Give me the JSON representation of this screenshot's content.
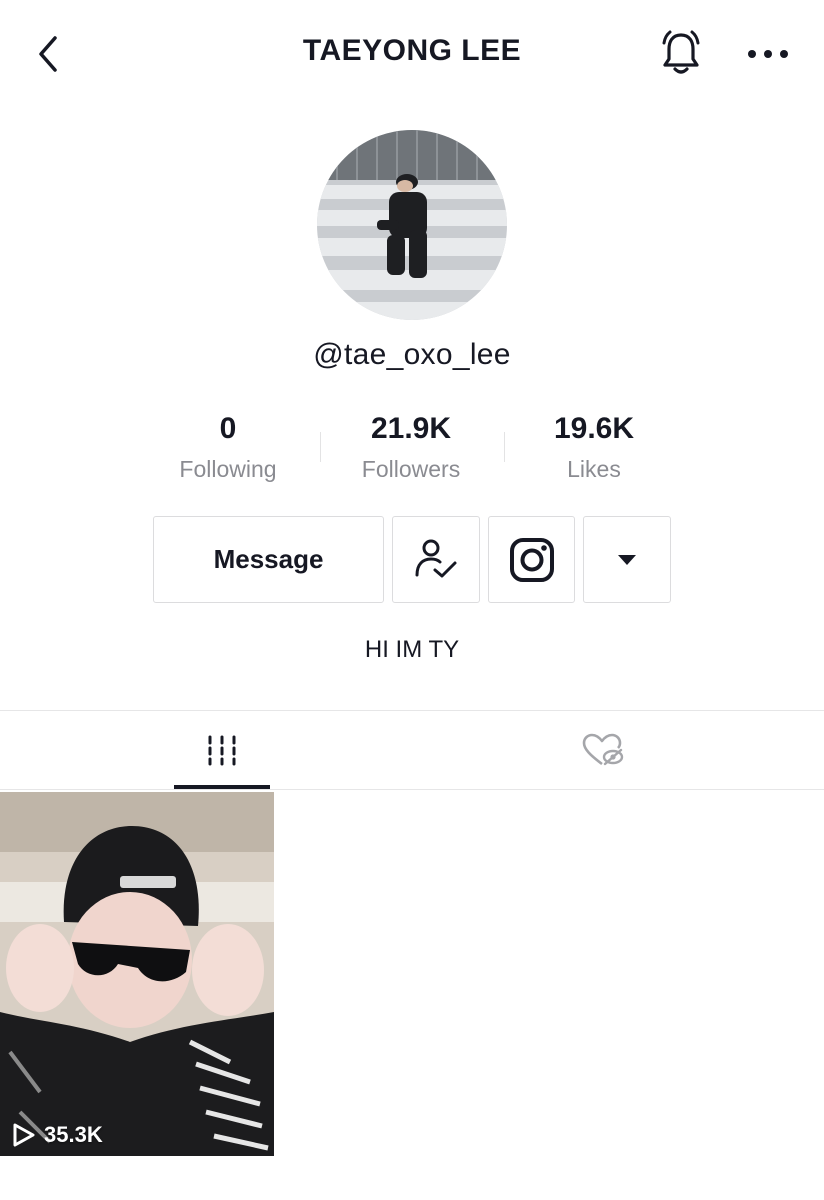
{
  "header": {
    "title": "TAEYONG LEE",
    "back_icon": "chevron-left-icon",
    "bell_icon": "bell-icon",
    "more_icon": "more-horizontal-icon"
  },
  "profile": {
    "username": "@tae_oxo_lee",
    "bio": "HI IM TY"
  },
  "stats": [
    {
      "value": "0",
      "label": "Following"
    },
    {
      "value": "21.9K",
      "label": "Followers"
    },
    {
      "value": "19.6K",
      "label": "Likes"
    }
  ],
  "actions": {
    "message_label": "Message",
    "friends_icon": "user-check-icon",
    "instagram_icon": "instagram-icon",
    "dropdown_icon": "caret-down-icon"
  },
  "tabs": [
    {
      "name": "videos",
      "icon": "grid-icon",
      "active": true
    },
    {
      "name": "liked",
      "icon": "liked-hidden-icon",
      "active": false
    }
  ],
  "videos": [
    {
      "views": "35.3K",
      "play_icon": "play-icon"
    }
  ],
  "colors": {
    "text": "#161823",
    "muted": "#8a8b91",
    "border": "#dcdcde"
  }
}
